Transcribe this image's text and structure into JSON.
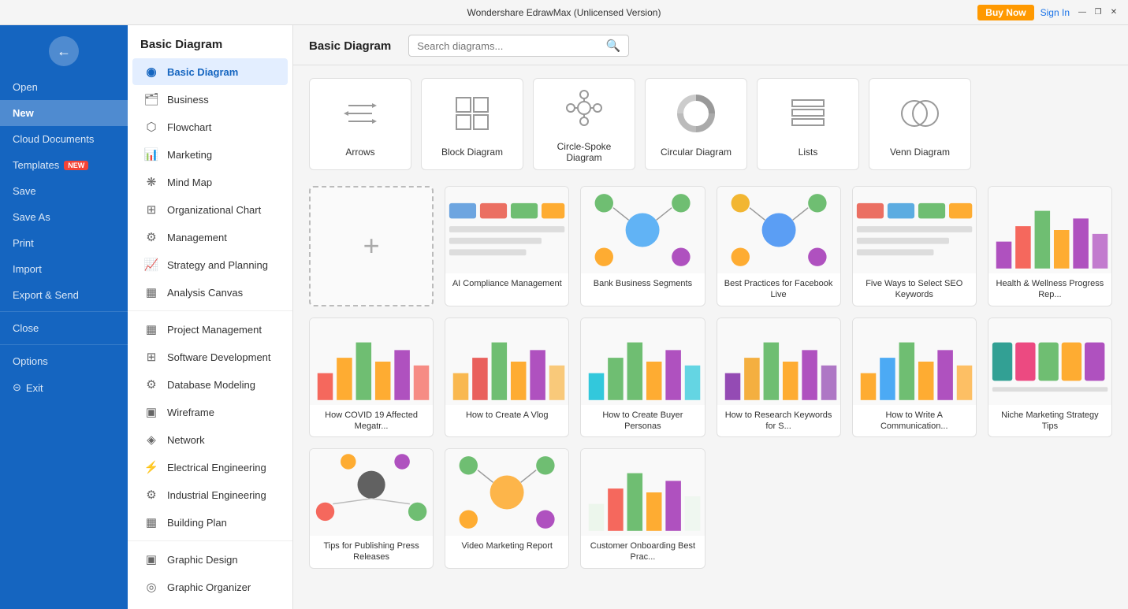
{
  "titlebar": {
    "title": "Wondershare EdrawMax (Unlicensed Version)",
    "buy_now": "Buy Now",
    "sign_in": "Sign In",
    "min_btn": "—",
    "max_btn": "❐",
    "close_btn": "✕"
  },
  "sidebar": {
    "logo_icon": "←",
    "items": [
      {
        "label": "Open",
        "id": "open"
      },
      {
        "label": "New",
        "id": "new",
        "active": true
      },
      {
        "label": "Cloud Documents",
        "id": "cloud"
      },
      {
        "label": "Templates",
        "id": "templates",
        "badge": "NEW"
      },
      {
        "label": "Save",
        "id": "save"
      },
      {
        "label": "Save As",
        "id": "save-as"
      },
      {
        "label": "Print",
        "id": "print"
      },
      {
        "label": "Import",
        "id": "import"
      },
      {
        "label": "Export & Send",
        "id": "export"
      },
      {
        "label": "Close",
        "id": "close"
      },
      {
        "label": "Options",
        "id": "options"
      },
      {
        "label": "Exit",
        "id": "exit",
        "icon": "⊝"
      }
    ]
  },
  "category_nav": {
    "header": "Basic Diagram",
    "categories": [
      {
        "label": "Basic Diagram",
        "id": "basic-diagram",
        "active": true,
        "icon": "◉"
      },
      {
        "label": "Business",
        "id": "business",
        "icon": "🗂"
      },
      {
        "label": "Flowchart",
        "id": "flowchart",
        "icon": "⬡"
      },
      {
        "label": "Marketing",
        "id": "marketing",
        "icon": "📊"
      },
      {
        "label": "Mind Map",
        "id": "mind-map",
        "icon": "⚙"
      },
      {
        "label": "Organizational Chart",
        "id": "org-chart",
        "icon": "☰"
      },
      {
        "label": "Management",
        "id": "management",
        "icon": "⚙"
      },
      {
        "label": "Strategy and Planning",
        "id": "strategy",
        "icon": "📈"
      },
      {
        "label": "Analysis Canvas",
        "id": "analysis",
        "icon": "▦"
      },
      {
        "label": "Project Management",
        "id": "project-mgmt",
        "icon": "▦"
      },
      {
        "label": "Software Development",
        "id": "software-dev",
        "icon": "☰"
      },
      {
        "label": "Database Modeling",
        "id": "database",
        "icon": "⚙"
      },
      {
        "label": "Wireframe",
        "id": "wireframe",
        "icon": "▣"
      },
      {
        "label": "Network",
        "id": "network",
        "icon": "◈"
      },
      {
        "label": "Electrical Engineering",
        "id": "electrical",
        "icon": "◎"
      },
      {
        "label": "Industrial Engineering",
        "id": "industrial",
        "icon": "⚙"
      },
      {
        "label": "Building Plan",
        "id": "building",
        "icon": "▦"
      },
      {
        "label": "Graphic Design",
        "id": "graphic-design",
        "icon": "▣"
      },
      {
        "label": "Graphic Organizer",
        "id": "graphic-org",
        "icon": "◎"
      }
    ]
  },
  "main": {
    "page_title": "Basic Diagram",
    "search_placeholder": "Search diagrams...",
    "icon_cards": [
      {
        "label": "Arrows",
        "icon": "arrows"
      },
      {
        "label": "Block Diagram",
        "icon": "block"
      },
      {
        "label": "Circle-Spoke Diagram",
        "icon": "circle-spoke"
      },
      {
        "label": "Circular Diagram",
        "icon": "circular"
      },
      {
        "label": "Lists",
        "icon": "lists"
      },
      {
        "label": "Venn Diagram",
        "icon": "venn"
      }
    ],
    "templates": [
      {
        "label": "AI Compliance Management",
        "color_top": "#4a90d9",
        "color_accent": "#e74c3c"
      },
      {
        "label": "Bank Business Segments",
        "color_top": "#2196F3",
        "color_accent": "#4CAF50"
      },
      {
        "label": "Best Practices for Facebook Live",
        "color_top": "#1877f2",
        "color_accent": "#f0a500"
      },
      {
        "label": "Five Ways to Select SEO Keywords",
        "color_top": "#e74c3c",
        "color_accent": "#3498db"
      },
      {
        "label": "Health & Wellness Progress Rep...",
        "color_top": "#9c27b0",
        "color_accent": "#f44336"
      },
      {
        "label": "How COVID 19 Affected Megatr...",
        "color_top": "#f44336",
        "color_accent": "#ff9800"
      },
      {
        "label": "How to Create A Vlog",
        "color_top": "#f9a825",
        "color_accent": "#e53935"
      },
      {
        "label": "How to Create Buyer Personas",
        "color_top": "#00bcd4",
        "color_accent": "#4caf50"
      },
      {
        "label": "How to Research Keywords for S...",
        "color_top": "#7b1fa2",
        "color_accent": "#f39c12"
      },
      {
        "label": "How to Write A Communication...",
        "color_top": "#ff9800",
        "color_accent": "#2196f3"
      },
      {
        "label": "Niche Marketing Strategy Tips",
        "color_top": "#00897b",
        "color_accent": "#e91e63"
      },
      {
        "label": "Tips for Publishing Press Releases",
        "color_top": "#212121",
        "color_accent": "#f44336"
      },
      {
        "label": "Video Marketing Report",
        "color_top": "#ff9800",
        "color_accent": "#4caf50"
      },
      {
        "label": "Customer Onboarding Best Prac...",
        "color_top": "#e8f5e9",
        "color_accent": "#f44336"
      }
    ]
  }
}
